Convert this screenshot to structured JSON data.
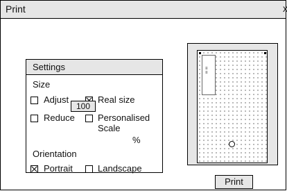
{
  "window": {
    "title": "Print",
    "close_label": "x"
  },
  "settings": {
    "title": "Settings",
    "size_label": "Size",
    "adjust_label": "Adjust",
    "real_size_label": "Real size",
    "reduce_label": "Reduce",
    "personalised_label_1": "Personalised",
    "personalised_label_2": "Scale",
    "scale_value": "100",
    "percent_label": "%",
    "orientation_label": "Orientation",
    "portrait_label": "Portrait",
    "landscape_label": "Landscape",
    "checked": {
      "adjust": false,
      "real_size": true,
      "reduce": false,
      "personalised": false,
      "portrait": true,
      "landscape": false
    }
  },
  "preview": {
    "icon": "page-preview"
  },
  "print_button": {
    "label": "Print"
  }
}
